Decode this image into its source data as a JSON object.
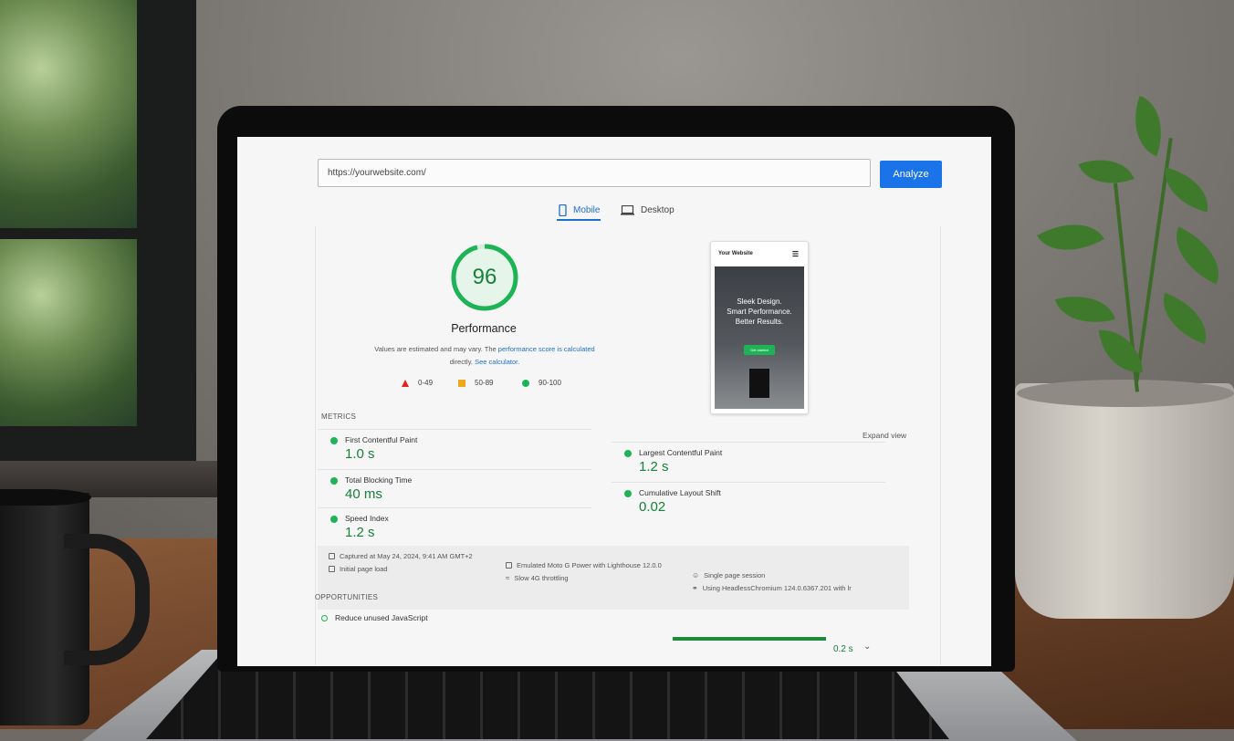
{
  "url_bar": {
    "value": "https://yourwebsite.com/",
    "button": "Analyze"
  },
  "tabs": [
    {
      "label": "Mobile",
      "active": true,
      "icon": "phone-icon"
    },
    {
      "label": "Desktop",
      "active": false,
      "icon": "monitor-icon"
    }
  ],
  "score": {
    "value": "96",
    "fraction": 0.96,
    "title": "Performance",
    "note_text": "Values are estimated and may vary. The",
    "note_link1": "performance score is calculated",
    "note_text2": "directly.",
    "note_link2": "See calculator."
  },
  "legend": [
    {
      "range": "0-49",
      "shape": "triangle",
      "color": "#e1251b"
    },
    {
      "range": "50-89",
      "shape": "square",
      "color": "#f0a91f"
    },
    {
      "range": "90-100",
      "shape": "circle",
      "color": "#1fb357"
    }
  ],
  "preview": {
    "site_name": "Your Website",
    "hero_lines": [
      "Sleek Design.",
      "Smart Performance.",
      "Better Results."
    ],
    "hero_button": "Get started"
  },
  "metrics": {
    "label": "METRICS",
    "expand": "Expand view",
    "left": [
      {
        "name": "First Contentful Paint",
        "value": "1.0 s"
      },
      {
        "name": "Total Blocking Time",
        "value": "40 ms"
      },
      {
        "name": "Speed Index",
        "value": "1.2 s"
      }
    ],
    "right": [
      {
        "name": "Largest Contentful Paint",
        "value": "1.2 s"
      },
      {
        "name": "Cumulative Layout Shift",
        "value": "0.02"
      }
    ]
  },
  "info": {
    "captured": "Captured at May 24, 2024, 9:41 AM GMT+2",
    "load": "Initial page load",
    "device": "Emulated Moto G Power with Lighthouse 12.0.0",
    "throttle": "Slow 4G throttling",
    "session": "Single page session",
    "browser": "Using HeadlessChromium 124.0.6367.201 with lr"
  },
  "opportunities": {
    "label": "OPPORTUNITIES",
    "item": "Reduce unused JavaScript",
    "value": "0.2 s"
  },
  "colors": {
    "accent": "#1a73e8",
    "good": "#1fb357",
    "good_text": "#18803a"
  }
}
